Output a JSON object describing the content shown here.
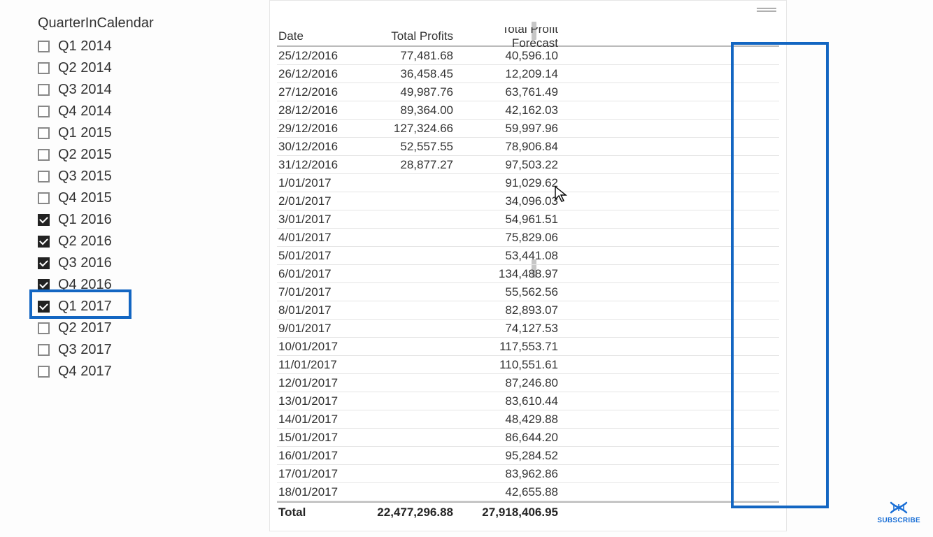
{
  "slicer": {
    "title": "QuarterInCalendar",
    "items": [
      {
        "label": "Q1 2014",
        "checked": false
      },
      {
        "label": "Q2 2014",
        "checked": false
      },
      {
        "label": "Q3 2014",
        "checked": false
      },
      {
        "label": "Q4 2014",
        "checked": false
      },
      {
        "label": "Q1 2015",
        "checked": false
      },
      {
        "label": "Q2 2015",
        "checked": false
      },
      {
        "label": "Q3 2015",
        "checked": false
      },
      {
        "label": "Q4 2015",
        "checked": false
      },
      {
        "label": "Q1 2016",
        "checked": true
      },
      {
        "label": "Q2 2016",
        "checked": true
      },
      {
        "label": "Q3 2016",
        "checked": true
      },
      {
        "label": "Q4 2016",
        "checked": true
      },
      {
        "label": "Q1 2017",
        "checked": true
      },
      {
        "label": "Q2 2017",
        "checked": false
      },
      {
        "label": "Q3 2017",
        "checked": false
      },
      {
        "label": "Q4 2017",
        "checked": false
      }
    ]
  },
  "table": {
    "headers": {
      "date": "Date",
      "profits": "Total Profits",
      "forecast": "Total Profit Forecast"
    },
    "rows": [
      {
        "date": "25/12/2016",
        "profits": "77,481.68",
        "forecast": "40,596.10"
      },
      {
        "date": "26/12/2016",
        "profits": "36,458.45",
        "forecast": "12,209.14"
      },
      {
        "date": "27/12/2016",
        "profits": "49,987.76",
        "forecast": "63,761.49"
      },
      {
        "date": "28/12/2016",
        "profits": "89,364.00",
        "forecast": "42,162.03"
      },
      {
        "date": "29/12/2016",
        "profits": "127,324.66",
        "forecast": "59,997.96"
      },
      {
        "date": "30/12/2016",
        "profits": "52,557.55",
        "forecast": "78,906.84"
      },
      {
        "date": "31/12/2016",
        "profits": "28,877.27",
        "forecast": "97,503.22"
      },
      {
        "date": "1/01/2017",
        "profits": "",
        "forecast": "91,029.62"
      },
      {
        "date": "2/01/2017",
        "profits": "",
        "forecast": "34,096.03"
      },
      {
        "date": "3/01/2017",
        "profits": "",
        "forecast": "54,961.51"
      },
      {
        "date": "4/01/2017",
        "profits": "",
        "forecast": "75,829.06"
      },
      {
        "date": "5/01/2017",
        "profits": "",
        "forecast": "53,441.08"
      },
      {
        "date": "6/01/2017",
        "profits": "",
        "forecast": "134,488.97"
      },
      {
        "date": "7/01/2017",
        "profits": "",
        "forecast": "55,562.56"
      },
      {
        "date": "8/01/2017",
        "profits": "",
        "forecast": "82,893.07"
      },
      {
        "date": "9/01/2017",
        "profits": "",
        "forecast": "74,127.53"
      },
      {
        "date": "10/01/2017",
        "profits": "",
        "forecast": "117,553.71"
      },
      {
        "date": "11/01/2017",
        "profits": "",
        "forecast": "110,551.61"
      },
      {
        "date": "12/01/2017",
        "profits": "",
        "forecast": "87,246.80"
      },
      {
        "date": "13/01/2017",
        "profits": "",
        "forecast": "83,610.44"
      },
      {
        "date": "14/01/2017",
        "profits": "",
        "forecast": "48,429.88"
      },
      {
        "date": "15/01/2017",
        "profits": "",
        "forecast": "86,644.20"
      },
      {
        "date": "16/01/2017",
        "profits": "",
        "forecast": "95,284.52"
      },
      {
        "date": "17/01/2017",
        "profits": "",
        "forecast": "83,962.86"
      },
      {
        "date": "18/01/2017",
        "profits": "",
        "forecast": "42,655.88"
      }
    ],
    "total": {
      "label": "Total",
      "profits": "22,477,296.88",
      "forecast": "27,918,406.95"
    }
  },
  "subscribe": {
    "label": "SUBSCRIBE"
  }
}
